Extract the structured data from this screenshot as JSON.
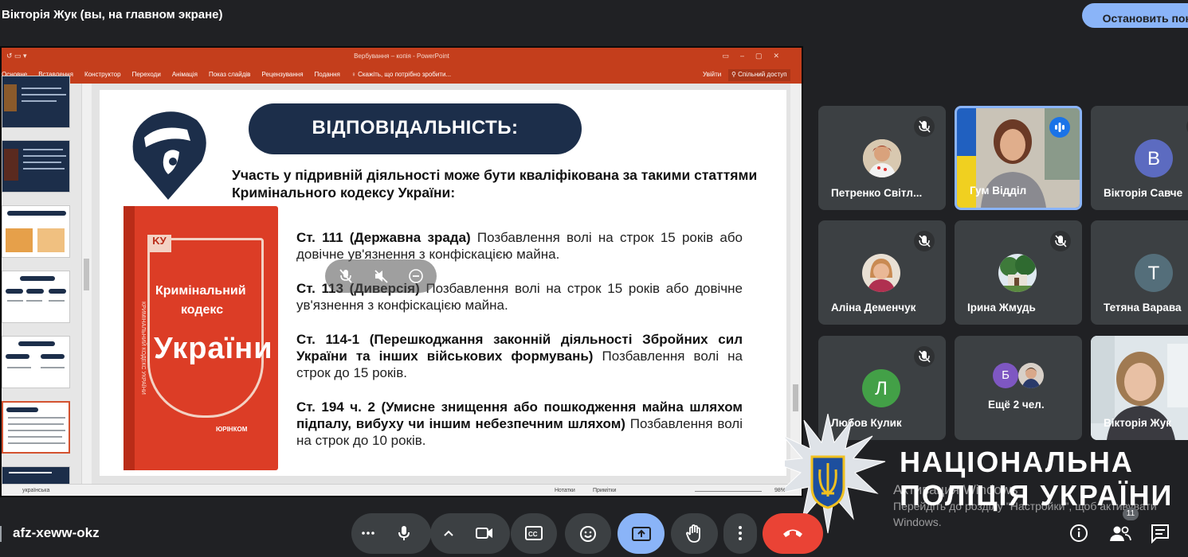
{
  "topbar": {
    "presenter": "Вікторія Жук (вы, на главном экране)",
    "stop_presenting": "Остановить показ"
  },
  "powerpoint": {
    "window_title": "Вербування – копія - PowerPoint",
    "tabs": [
      "Основне",
      "Вставлення",
      "Конструктор",
      "Переходи",
      "Анімація",
      "Показ слайдів",
      "Рецензування",
      "Подання",
      "Скажіть, що потрібно зробити..."
    ],
    "sign_in": "Увійти",
    "share": "Спільний доступ",
    "status": {
      "language": "українська",
      "notes": "Нотатки",
      "comments": "Примітки",
      "zoom": "98%"
    },
    "slide": {
      "title": "ВІДПОВІДАЛЬНІСТЬ:",
      "intro": "Участь у підривній діяльності може бути кваліфікована за такими статтями Кримінального кодексу України:",
      "articles": [
        {
          "head": "Ст. 111 (Державна зрада)",
          "body": " Позбавлення волі на строк 15 років або довічне ув'язнення з конфіскацією майна."
        },
        {
          "head": "Ст. 113 (Диверсія)",
          "body": " Позбавлення волі на строк 15 років або довічне ув'язнення з конфіскацією майна."
        },
        {
          "head": "Ст. 114-1 (Перешкоджання законній діяльності Збройних сил України та інших військових формувань)",
          "body": " Позбавлення волі на строк до 15 років."
        },
        {
          "head": "Ст. 194 ч. 2 (Умисне знищення або пошкодження майна шляхом підпалу, вибуху чи іншим небезпечним шляхом)",
          "body": " Позбавлення волі на строк до 10 років."
        }
      ],
      "book": {
        "logo": "KУ",
        "line1": "Кримінальний",
        "line2": "кодекс",
        "line3": "України",
        "publisher": "ЮРІНКОМ",
        "spine": "КРИМІНАЛЬНИЙ КОДЕКС УКРАЇНИ"
      }
    }
  },
  "participants": [
    {
      "name": "Петренко Світл...",
      "muted": true,
      "avatar": "photo"
    },
    {
      "name": "Гум Відділ",
      "muted": false,
      "speaking": true,
      "avatar": "video"
    },
    {
      "name": "Вікторія Савче",
      "muted": true,
      "avatar": "letter",
      "letter": "В",
      "color": "#5c6bc0"
    },
    {
      "name": "Аліна Деменчук",
      "muted": true,
      "avatar": "photo"
    },
    {
      "name": "Ірина Жмудь",
      "muted": true,
      "avatar": "photo"
    },
    {
      "name": "Тетяна Варава",
      "muted": true,
      "avatar": "letter",
      "letter": "Т",
      "color": "#546e7a"
    },
    {
      "name": "Любов Кулик",
      "muted": true,
      "avatar": "letter",
      "letter": "Л",
      "color": "#43a047"
    },
    {
      "name": "Ещё 2 чел.",
      "muted": false,
      "avatar": "group",
      "letter": "Б",
      "color": "#7e57c2"
    },
    {
      "name": "Вікторія Жук",
      "muted": false,
      "avatar": "video"
    }
  ],
  "watermark": {
    "line1": "НАЦІОНАЛЬНА",
    "line2": "ПОЛІЦІЯ УКРАЇНИ",
    "activate_head": "Активация Windows",
    "activate_body": "Перейдіть до розділу \"Настройки\", щоб активувати Windows."
  },
  "bottombar": {
    "meeting_code": "afz-xeww-okz",
    "participant_count": "11"
  },
  "colors": {
    "meet_bg": "#202124",
    "tile_bg": "#3c4043",
    "accent": "#8ab4f8",
    "hangup": "#ea4335",
    "ppt": "#c43e1c",
    "slide_navy": "#1c2e4a"
  }
}
